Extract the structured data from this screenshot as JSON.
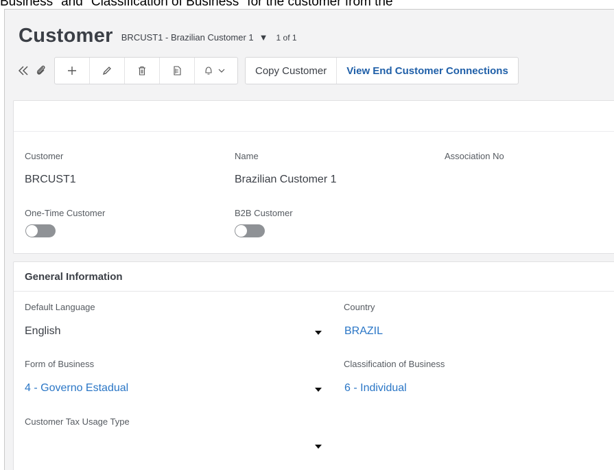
{
  "caption": "Business\" and \"Classification of Business\" for the customer from the",
  "header": {
    "title": "Customer",
    "record": "BRCUST1 - Brazilian Customer 1",
    "count": "1 of 1"
  },
  "toolbar": {
    "icons": [
      "collapse-icon",
      "attachment-icon",
      "add-icon",
      "edit-icon",
      "delete-icon",
      "duplicate-icon",
      "bell-icon",
      "chevron-down-icon"
    ],
    "copy_label": "Copy Customer",
    "connections_label": "View End Customer Connections"
  },
  "details": {
    "customer_label": "Customer",
    "customer_value": "BRCUST1",
    "name_label": "Name",
    "name_value": "Brazilian Customer 1",
    "association_label": "Association No",
    "association_value": "",
    "one_time_label": "One-Time Customer",
    "b2b_label": "B2B Customer"
  },
  "general": {
    "section_title": "General Information",
    "language_label": "Default Language",
    "language_value": "English",
    "country_label": "Country",
    "country_value": "BRAZIL",
    "form_label": "Form of Business",
    "form_value": "4 - Governo Estadual",
    "classification_label": "Classification of Business",
    "classification_value": "6 - Individual",
    "tax_label": "Customer Tax Usage Type",
    "tax_value": ""
  },
  "colors": {
    "link": "#2a76c6",
    "action_link": "#1f5fa8",
    "toggle_off": "#8f9296"
  }
}
